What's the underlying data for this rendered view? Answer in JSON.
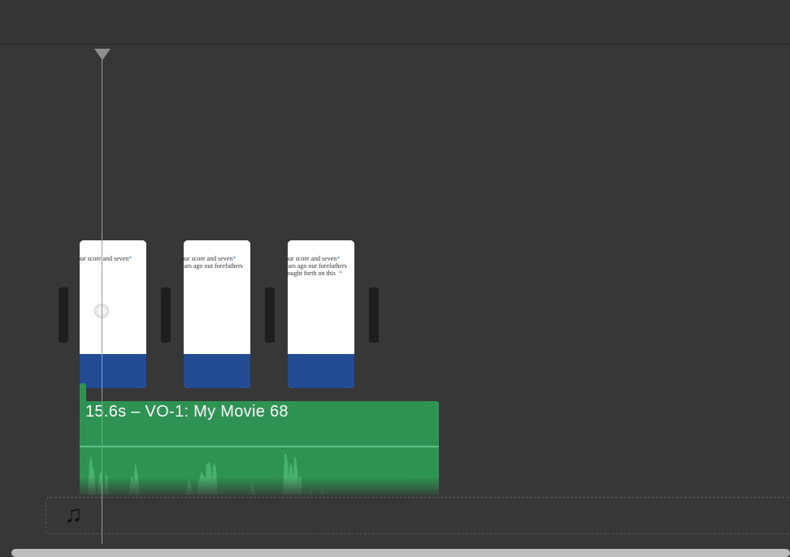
{
  "timeline": {
    "clips": [
      {
        "text": "our score and seven*"
      },
      {
        "text": "our score and seven*\nears ago our forefathers"
      },
      {
        "text": "our score and seven*\nears ago our forefathers\nrought forth on this  *"
      }
    ],
    "voiceover": {
      "label": "15.6s – VO-1: My Movie 68"
    },
    "music_well": {
      "icon": "music-note-icon"
    }
  },
  "colors": {
    "background": "#373737",
    "clip_band": "#224b93",
    "audio_clip": "#2e9252"
  }
}
